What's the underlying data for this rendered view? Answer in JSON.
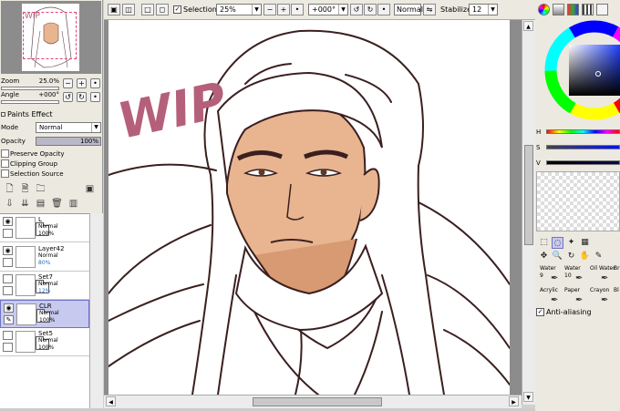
{
  "navigator": {
    "zoom_label": "Zoom",
    "zoom_value": "25.0%",
    "angle_label": "Angle",
    "angle_value": "+000°",
    "thumb_text": "WIP"
  },
  "paints_effect": {
    "title": "Paints Effect",
    "mode_label": "Mode",
    "mode_value": "Normal",
    "opacity_label": "Opacity",
    "opacity_value": "100%",
    "preserve_opacity": "Preserve Opacity",
    "clipping_group": "Clipping Group",
    "selection_source": "Selection Source"
  },
  "layers": [
    {
      "name": "L",
      "mode": "Normal",
      "opacity": "100%",
      "type": "folder",
      "visible": true,
      "selected": false,
      "op_color": "#000000"
    },
    {
      "name": "Layer42",
      "mode": "Normal",
      "opacity": "80%",
      "type": "layer",
      "visible": true,
      "selected": false,
      "op_color": "#2b6fbf"
    },
    {
      "name": "Set7",
      "mode": "Normal",
      "opacity": "12%",
      "type": "folder",
      "visible": false,
      "selected": false,
      "op_color": "#2b6fbf"
    },
    {
      "name": "CLR",
      "mode": "Normal",
      "opacity": "100%",
      "type": "folder",
      "visible": true,
      "selected": true,
      "op_color": "#000000"
    },
    {
      "name": "Set5",
      "mode": "Normal",
      "opacity": "100%",
      "type": "folder",
      "visible": false,
      "selected": false,
      "op_color": "#000000"
    }
  ],
  "toolbar": {
    "selection_label": "Selection",
    "zoom_value": "25%",
    "rotation_value": "+000°",
    "blend_mode": "Normal",
    "stabilizer_label": "Stabilizer",
    "stabilizer_value": "12"
  },
  "canvas": {
    "watermark_text": "WIP"
  },
  "color_panel": {
    "h_label": "H",
    "s_label": "S",
    "v_label": "V",
    "selected_color": "#0a0a4a"
  },
  "brushes": [
    {
      "name": "Water",
      "size": "9"
    },
    {
      "name": "Water",
      "size": "10"
    },
    {
      "name": "Oil Water",
      "size": ""
    },
    {
      "name": "Br",
      "size": ""
    },
    {
      "name": "Acrylic",
      "size": ""
    },
    {
      "name": "Paper",
      "size": ""
    },
    {
      "name": "Crayon",
      "size": ""
    },
    {
      "name": "Bl",
      "size": ""
    }
  ],
  "anti_aliasing": "Anti-aliasing",
  "colors": {
    "layer_selected_bg": "#c7c9ef",
    "wip_color": "#b5607a",
    "line_color": "#3b1f1f",
    "skin": "#e8b590"
  }
}
